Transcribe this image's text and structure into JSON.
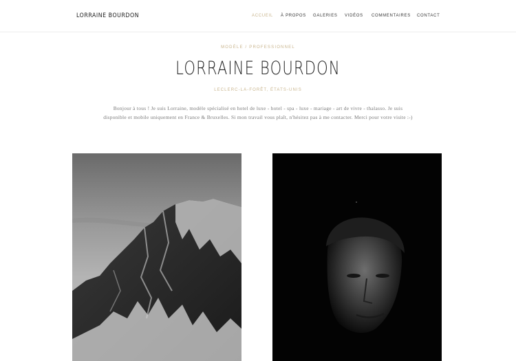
{
  "site": {
    "logo": "LORRAINE BOURDON"
  },
  "nav": {
    "items": [
      {
        "label": "ACCUEIL",
        "active": true
      },
      {
        "label": "À PROPOS",
        "active": false
      },
      {
        "label": "GALERIES",
        "active": false
      },
      {
        "label": "VIDÉOS",
        "active": false
      },
      {
        "label": "COMMENTAIRES",
        "active": false
      },
      {
        "label": "CONTACT",
        "active": false
      }
    ]
  },
  "hero": {
    "tagline": "MODÈLE / PROFESSIONNEL",
    "name": "LORRAINE BOURDON",
    "location": "LECLERC-LA-FORÊT, ÉTATS-UNIS",
    "bio": "Bonjour à tous ! Je suis Lorraine, modèle spécialisé en hotel de luxe - hotel - spa - luxe - mariage - art de vivre - thalasso. Je suis disponible et mobile uniquement en France & Bruxelles. Si mon travail vous plaît, n'hésitez pas à me contacter. Merci pour votre visite :-)"
  },
  "gallery": {
    "photos": [
      {
        "subject": "mountain-photo"
      },
      {
        "subject": "portrait-photo"
      }
    ]
  },
  "colors": {
    "accent": "#c8b48c",
    "text": "#222222",
    "muted": "#777777"
  }
}
